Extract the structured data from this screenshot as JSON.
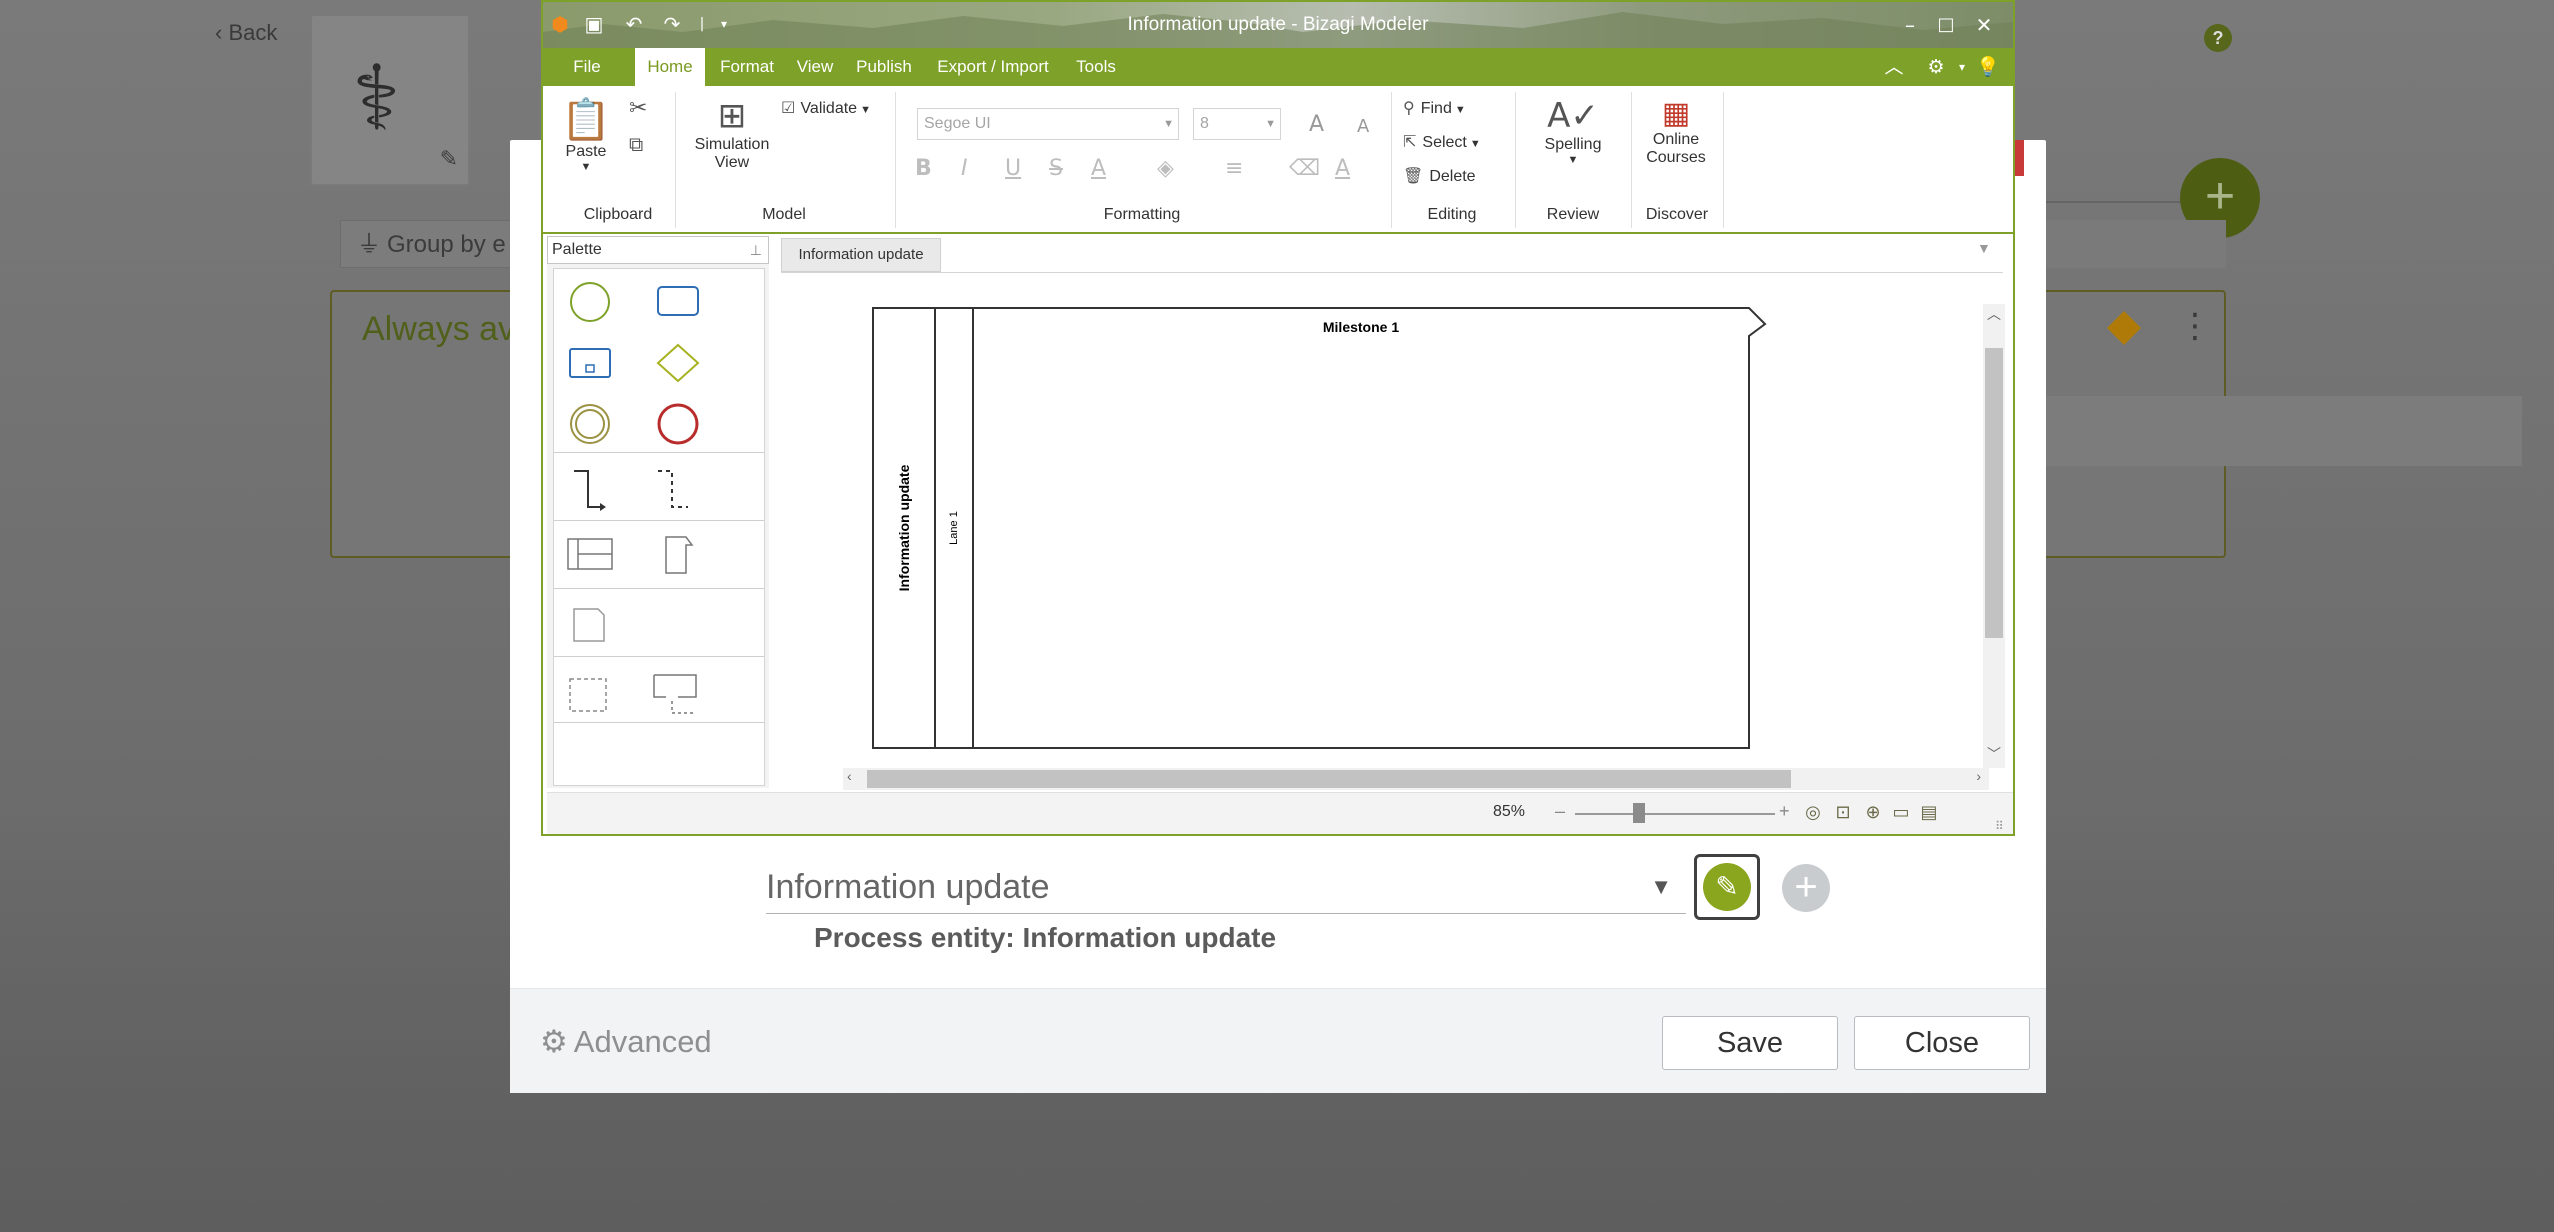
{
  "background": {
    "back_label": "Back",
    "help_label": "?",
    "group_by_label": "Group by e",
    "card_title": "Always av",
    "fab_label": "+"
  },
  "modeler": {
    "title": "Information update - Bizagi Modeler",
    "ribbon_tabs": [
      "File",
      "Home",
      "Format",
      "View",
      "Publish",
      "Export / Import",
      "Tools"
    ],
    "active_tab": "Home",
    "clipboard": {
      "paste": "Paste",
      "group": "Clipboard"
    },
    "model": {
      "simulation_view_line1": "Simulation",
      "simulation_view_line2": "View",
      "validate": "Validate",
      "group": "Model"
    },
    "formatting": {
      "font": "Segoe UI",
      "size": "8",
      "group": "Formatting"
    },
    "editing": {
      "find": "Find",
      "select": "Select",
      "delete": "Delete",
      "group": "Editing"
    },
    "review": {
      "spelling": "Spelling",
      "group": "Review"
    },
    "discover": {
      "online_courses_line1": "Online",
      "online_courses_line2": "Courses",
      "group": "Discover"
    },
    "palette_title": "Palette",
    "doc_tab": "Information update",
    "diagram": {
      "pool_name": "Information update",
      "lane_name": "Lane 1",
      "milestone": "Milestone 1"
    },
    "zoom": "85%",
    "zoom_level": 0.32
  },
  "dialog": {
    "process_select": "Information update",
    "process_entity": "Process entity: Information update",
    "advanced": "Advanced",
    "save": "Save",
    "close": "Close"
  },
  "colors": {
    "accent": "#7ea129",
    "green_dark": "#4d5d12",
    "danger": "#c83a3a",
    "warning": "#b07a08"
  }
}
